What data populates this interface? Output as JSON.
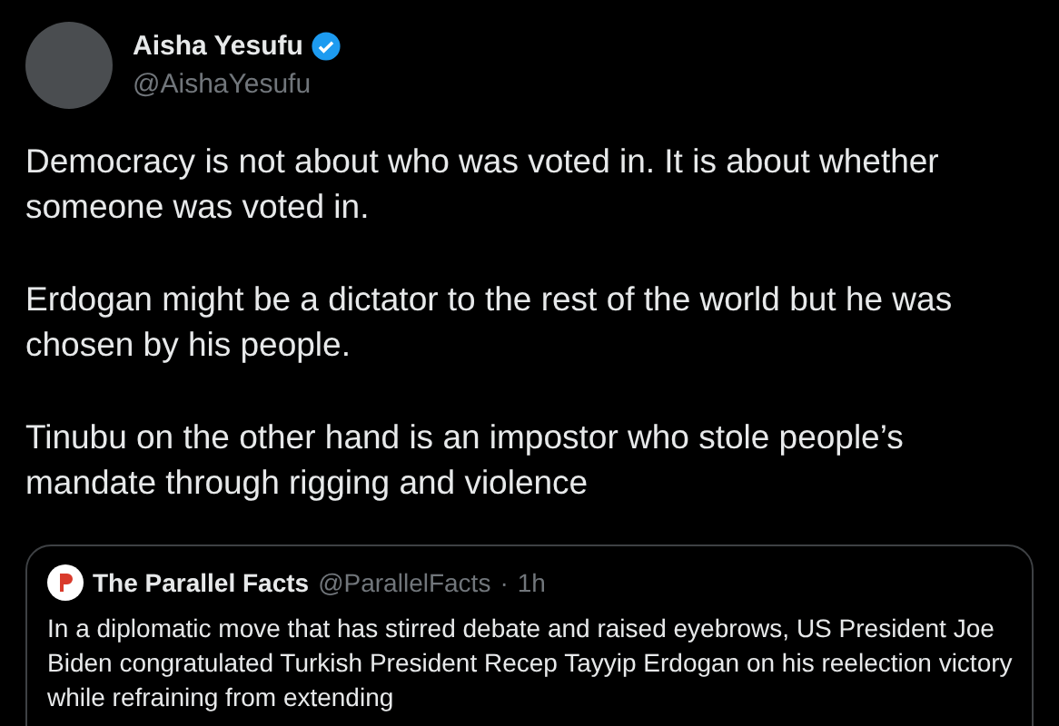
{
  "author": {
    "name": "Aisha Yesufu",
    "verified": true,
    "handle": "@AishaYesufu"
  },
  "paragraphs": [
    "Democracy is not about who was voted in. It is about whether someone was voted in.",
    "Erdogan might be a dictator to the rest of the world but he was chosen by his people.",
    "Tinubu on the other hand is an impostor who stole people’s mandate through rigging and violence"
  ],
  "quote": {
    "name": "The Parallel Facts",
    "handle": "@ParallelFacts",
    "separator": "·",
    "time": "1h",
    "text": "In a diplomatic move that has stirred debate and raised eyebrows, US President Joe Biden congratulated Turkish President Recep Tayyip Erdogan on his reelection victory while refraining from extending"
  }
}
